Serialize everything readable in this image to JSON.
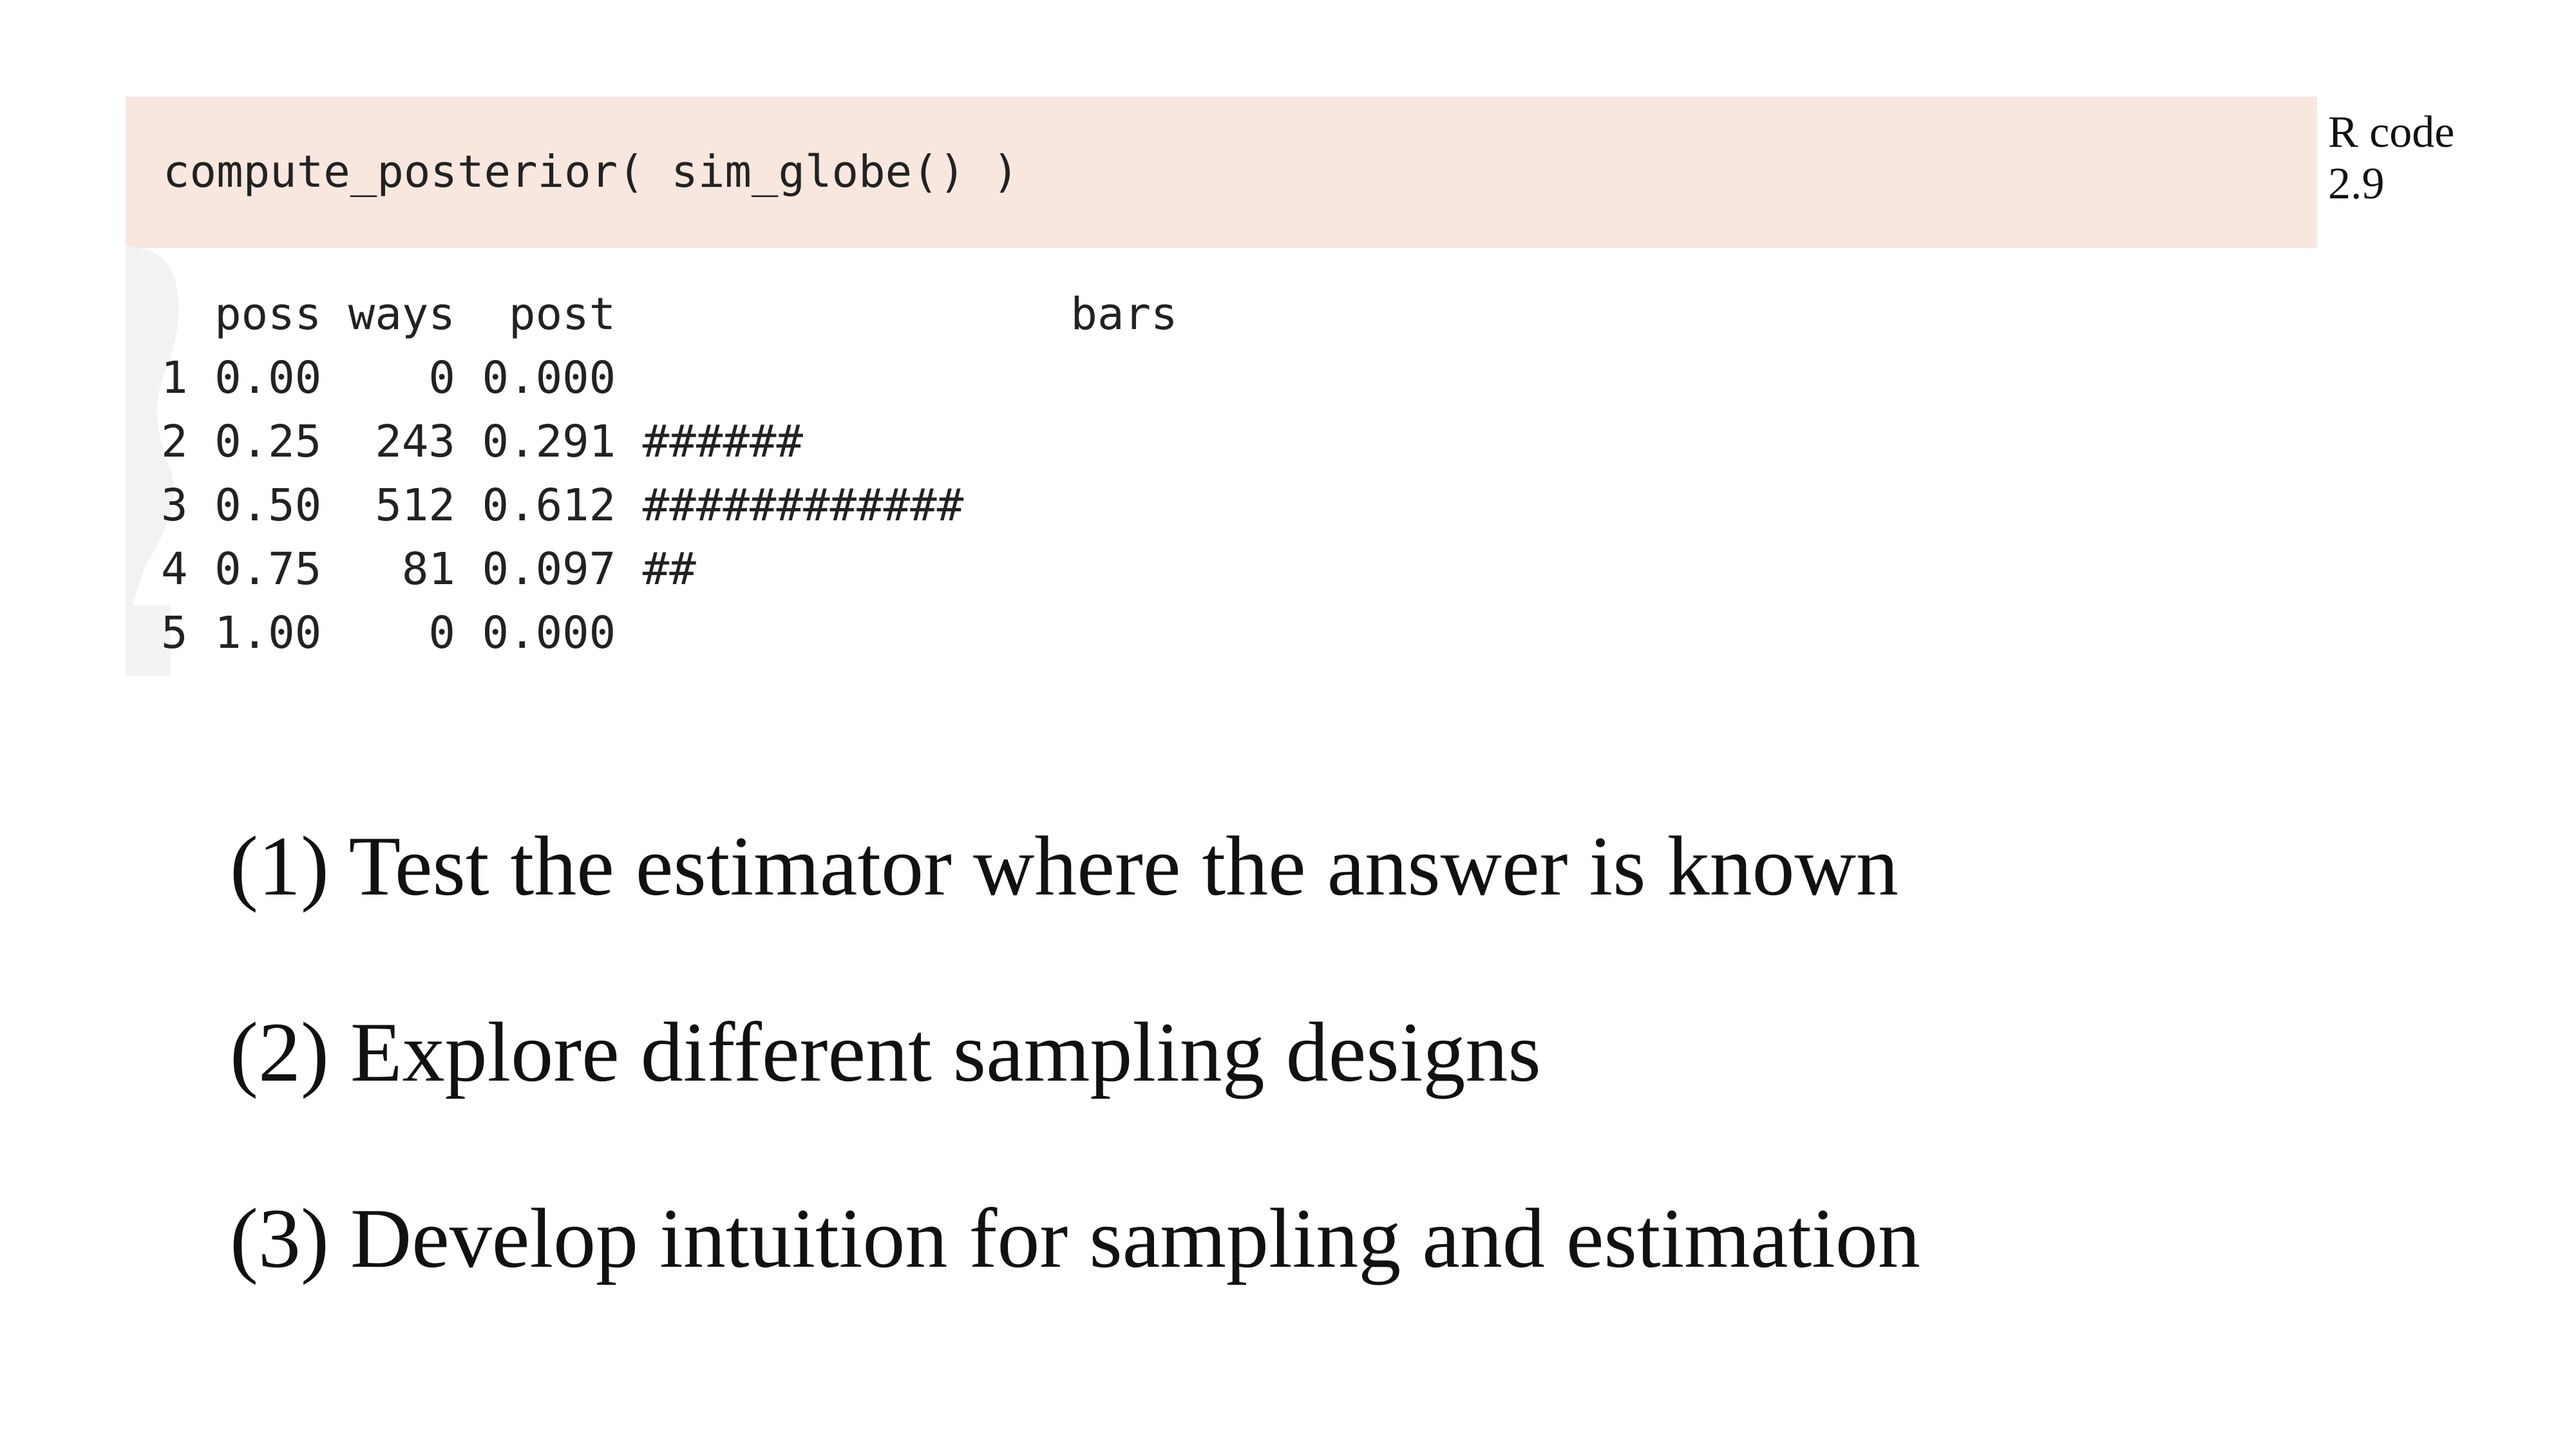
{
  "code": {
    "input": "compute_posterior( sim_globe() )",
    "label_line1": "R code",
    "label_line2": "2.9"
  },
  "output": {
    "lines": [
      "  poss ways  post                 bars",
      "1 0.00    0 0.000",
      "2 0.25  243 0.291 ######",
      "3 0.50  512 0.612 ############",
      "4 0.75   81 0.097 ##",
      "5 1.00    0 0.000"
    ]
  },
  "points": [
    "(1) Test the estimator where the answer is known",
    "(2) Explore different sampling designs",
    "(3) Develop intuition for sampling and estimation"
  ]
}
